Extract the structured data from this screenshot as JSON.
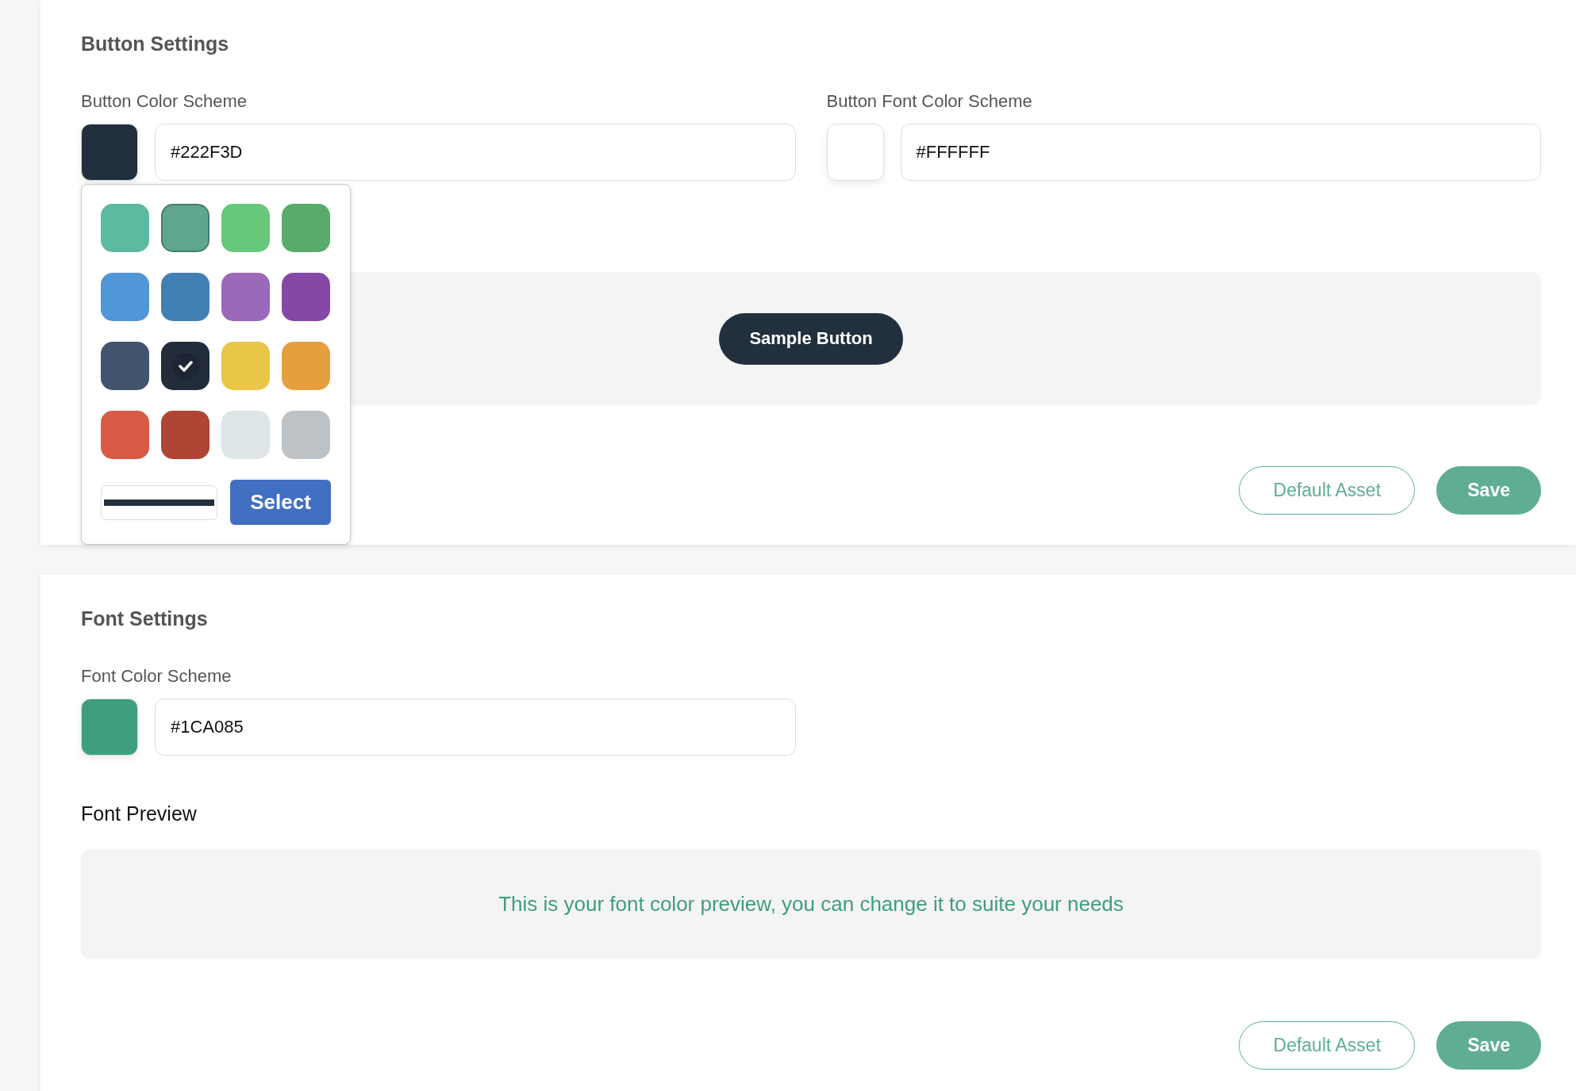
{
  "sections": [
    {
      "kind": "button",
      "title": "Button Settings",
      "fields": [
        {
          "label": "Button Color Scheme",
          "value": "#222F3D",
          "color": "#222f3d"
        },
        {
          "label": "Button Font Color Scheme",
          "value": "#FFFFFF",
          "color": "#ffffff"
        }
      ],
      "color_picker": {
        "swatches": [
          {
            "color": "#5bba9f",
            "selected": false,
            "outlined": false
          },
          {
            "color": "#5ea68f",
            "selected": false,
            "outlined": true
          },
          {
            "color": "#67c77b",
            "selected": false,
            "outlined": false
          },
          {
            "color": "#58ab69",
            "selected": false,
            "outlined": false
          },
          {
            "color": "#5196d6",
            "selected": false,
            "outlined": false
          },
          {
            "color": "#427fb4",
            "selected": false,
            "outlined": false
          },
          {
            "color": "#9b68ba",
            "selected": false,
            "outlined": false
          },
          {
            "color": "#8548a7",
            "selected": false,
            "outlined": false
          },
          {
            "color": "#42546d",
            "selected": false,
            "outlined": false
          },
          {
            "color": "#222c3a",
            "selected": true,
            "outlined": false
          },
          {
            "color": "#e9c646",
            "selected": false,
            "outlined": false
          },
          {
            "color": "#e59f3e",
            "selected": false,
            "outlined": false
          },
          {
            "color": "#d85a46",
            "selected": false,
            "outlined": false
          },
          {
            "color": "#b04435",
            "selected": false,
            "outlined": false
          },
          {
            "color": "#dee5e7",
            "selected": false,
            "outlined": false
          },
          {
            "color": "#bdc2c6",
            "selected": false,
            "outlined": false
          }
        ],
        "custom_input": {
          "color": "#222f3d"
        },
        "button": "Select"
      },
      "preview": {
        "button": "Sample Button"
      },
      "actions": [
        {
          "label": "Default Asset",
          "kind": "outline"
        },
        {
          "label": "Save",
          "kind": "filled"
        }
      ]
    },
    {
      "kind": "font",
      "title": "Font Settings",
      "fields": [
        {
          "label": "Font Color Scheme",
          "value": "#1CA085",
          "color": "#3f9d80"
        }
      ],
      "preview_label": "Font Preview",
      "preview": {
        "text": "This is your font color preview, you can change it to suite your needs"
      },
      "actions": [
        {
          "label": "Default Asset",
          "kind": "outline"
        },
        {
          "label": "Save",
          "kind": "filled"
        }
      ]
    }
  ]
}
